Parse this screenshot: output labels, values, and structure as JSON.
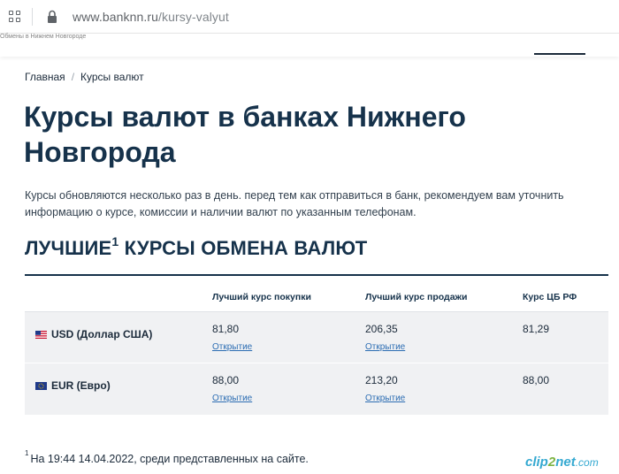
{
  "browser": {
    "url_host": "www.banknn.ru",
    "url_path": "/kursy-valyut"
  },
  "site_header": {
    "cut_text": "Обмены в Нижнем Новгороде"
  },
  "breadcrumb": {
    "home": "Главная",
    "separator": "/",
    "current": "Курсы валют"
  },
  "page": {
    "title": "Курсы валют в банках Нижнего Новгорода",
    "intro": "Курсы обновляются несколько раз в день. перед тем как отправиться в банк, рекомендуем вам уточнить информацию о курсе, комиссии и наличии валют по указанным телефонам.",
    "section_title": "ЛУЧШИЕ",
    "section_title_sup": "1",
    "section_title_rest": " КУРСЫ ОБМЕНА ВАЛЮТ"
  },
  "table": {
    "headers": {
      "buy": "Лучший курс покупки",
      "sell": "Лучший курс продажи",
      "cb": "Курс ЦБ РФ"
    },
    "rows": [
      {
        "currency": "USD (Доллар США)",
        "flag": "us-flag-icon",
        "buy": "81,80",
        "buy_bank": "Открытие",
        "sell": "206,35",
        "sell_bank": "Открытие",
        "cb": "81,29"
      },
      {
        "currency": "EUR (Евро)",
        "flag": "eu-flag-icon",
        "buy": "88,00",
        "buy_bank": "Открытие",
        "sell": "213,20",
        "sell_bank": "Открытие",
        "cb": "88,00"
      }
    ]
  },
  "footnote": {
    "mark": "1",
    "text": "На 19:44 14.04.2022, среди представленных на сайте."
  },
  "watermark": {
    "part1": "clip",
    "part2": "2",
    "part3": "net",
    "part4": ".com"
  },
  "colors": {
    "heading": "#16324b",
    "link": "#2c6db3",
    "row_bg": "#f0f1f3"
  }
}
